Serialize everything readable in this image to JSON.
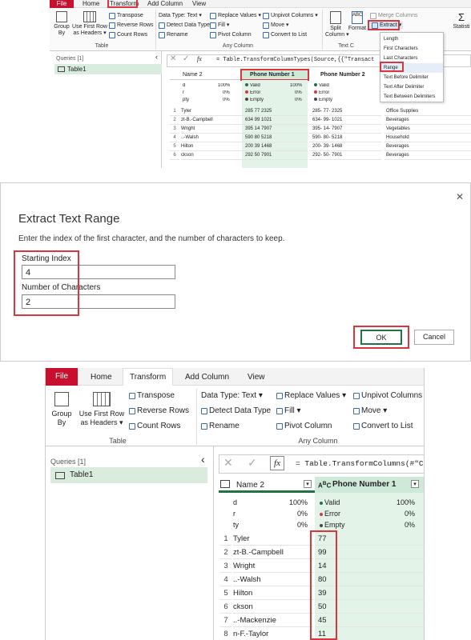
{
  "top": {
    "tabs": [
      "File",
      "Home",
      "Transform",
      "Add Column",
      "View"
    ],
    "table_group": {
      "group_by": "Group\nBy",
      "first_row": "Use First Row\nas Headers ▾",
      "transpose": "Transpose",
      "reverse_rows": "Reverse Rows",
      "count_rows": "Count Rows",
      "label": "Table"
    },
    "any_column": {
      "data_type": "Data Type: Text ▾",
      "detect": "Detect Data Type",
      "rename": "Rename",
      "replace": "Replace Values ▾",
      "fill": "Fill ▾",
      "pivot": "Pivot Column",
      "unpivot": "Unpivot Columns ▾",
      "move": "Move ▾",
      "convert": "Convert to List",
      "label": "Any Column"
    },
    "text_group": {
      "split": "Split\nColumn ▾",
      "format": "Format",
      "merge": "Merge Columns",
      "extract": "Extract ▾",
      "label": "Text C",
      "stats": "Statisti"
    },
    "extract_menu": [
      "Length",
      "First Characters",
      "Last Characters",
      "Range",
      "Text Before Delimiter",
      "Text After Delimiter",
      "Text Between Delimiters"
    ],
    "queries_label": "Queries [1]",
    "query_name": "Table1",
    "formula": "= Table.TransformColumnTypes(Source,{{\"Transact",
    "fx": "fx",
    "columns": [
      "Name 2",
      "Phone Number 1",
      "Phone Number 2"
    ],
    "stats": [
      [
        "d",
        "100%",
        "Valid",
        "100%",
        "Valid"
      ],
      [
        "r",
        "0%",
        "Error",
        "0%",
        "Error"
      ],
      [
        "pty",
        "0%",
        "Empty",
        "0%",
        "Empty"
      ]
    ],
    "rows": [
      [
        "1",
        "Tyler",
        "285 77 2325",
        "285- 77- 2325",
        "Office Supplies"
      ],
      [
        "2",
        "zt-B.-Campbell",
        "634 99 1021",
        "634- 99- 1021",
        "Beverages"
      ],
      [
        "3",
        "Wright",
        "395 14 7907",
        "395- 14- 7907",
        "Vegetables"
      ],
      [
        "4",
        "..-Walsh",
        "590 80 5218",
        "590- 80- 5218",
        "Household"
      ],
      [
        "5",
        "Hilton",
        "200 39 1468",
        "200- 39- 1468",
        "Beverages"
      ],
      [
        "6",
        "ckson",
        "292 50 7901",
        "292- 50- 7901",
        "Beverages"
      ]
    ]
  },
  "dialog": {
    "title": "Extract Text Range",
    "description": "Enter the index of the first character, and the number of characters to keep.",
    "start_label": "Starting Index",
    "start_value": "4",
    "count_label": "Number of Characters",
    "count_value": "2",
    "ok": "OK",
    "cancel": "Cancel",
    "close": "✕"
  },
  "bottom": {
    "tabs": [
      "File",
      "Home",
      "Transform",
      "Add Column",
      "View"
    ],
    "table_group": {
      "group_by": "Group\nBy",
      "first_row": "Use First Row\nas Headers ▾",
      "transpose": "Transpose",
      "reverse_rows": "Reverse Rows",
      "count_rows": "Count Rows",
      "label": "Table"
    },
    "any_column": {
      "data_type": "Data Type: Text ▾",
      "detect": "Detect Data Type",
      "rename": "Rename",
      "replace": "Replace Values ▾",
      "fill": "Fill ▾",
      "pivot": "Pivot Column",
      "unpivot": "Unpivot Columns",
      "move": "Move ▾",
      "convert": "Convert to List",
      "label": "Any Column"
    },
    "queries_label": "Queries [1]",
    "query_name": "Table1",
    "formula": "= Table.TransformColumns(#\"Ch",
    "fx": "fx",
    "columns": [
      "Name 2",
      "Phone Number 1"
    ],
    "stats": [
      [
        "d",
        "100%",
        "Valid",
        "100%"
      ],
      [
        "r",
        "0%",
        "Error",
        "0%"
      ],
      [
        "ty",
        "0%",
        "Empty",
        "0%"
      ]
    ],
    "rows": [
      [
        "1",
        "Tyler",
        "77"
      ],
      [
        "2",
        "zt-B.-Campbell",
        "99"
      ],
      [
        "3",
        "Wright",
        "14"
      ],
      [
        "4",
        "..-Walsh",
        "80"
      ],
      [
        "5",
        "Hilton",
        "39"
      ],
      [
        "6",
        "ckson",
        "50"
      ],
      [
        "7",
        "..-Mackenzie",
        "45"
      ],
      [
        "8",
        "n-F.-Taylor",
        "11"
      ]
    ]
  },
  "colors": {
    "accent": "#217346",
    "red": "#d9363e",
    "file": "#c8102e"
  }
}
